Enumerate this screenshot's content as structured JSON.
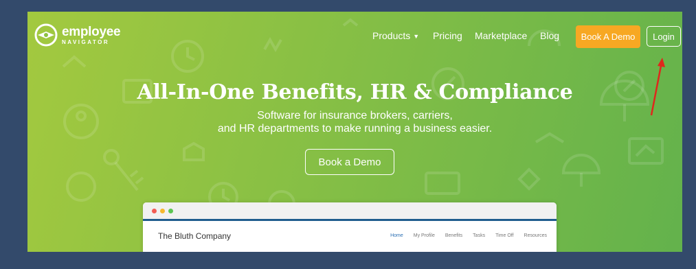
{
  "logo": {
    "word": "employee",
    "sub": "NAVIGATOR"
  },
  "nav": {
    "items": [
      "Products",
      "Pricing",
      "Marketplace",
      "Blog"
    ],
    "book_label": "Book A Demo",
    "login_label": "Login"
  },
  "hero": {
    "title": "All-In-One Benefits, HR & Compliance",
    "subtitle_line1": "Software for insurance brokers, carriers,",
    "subtitle_line2": "and HR departments to make running a business easier.",
    "cta": "Book a Demo"
  },
  "app_preview": {
    "company": "The Bluth Company",
    "tabs": [
      "Home",
      "My Profile",
      "Benefits",
      "Tasks",
      "Time Off",
      "Resources"
    ]
  },
  "colors": {
    "accent": "#f7a823",
    "frame_bg": "#334a6b",
    "annotation": "#e0271c"
  }
}
